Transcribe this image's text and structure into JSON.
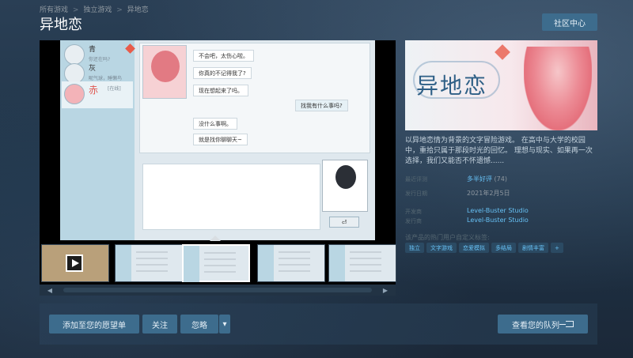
{
  "breadcrumb": [
    "所有游戏",
    "独立游戏",
    "异地恋"
  ],
  "breadcrumb_sep": ">",
  "title": "异地恋",
  "community_button": "社区中心",
  "screenshot": {
    "contacts": [
      {
        "name": "青",
        "sub": "你还在吗?"
      },
      {
        "name": "灰",
        "sub": "昵气球，睡懒鸟"
      },
      {
        "name": "赤",
        "sub": "[在线]"
      }
    ],
    "messages": [
      {
        "text": "不会吧，太伤心啦。",
        "me": false
      },
      {
        "text": "你真的不记得我了?",
        "me": false
      },
      {
        "text": "现在想起来了吗。",
        "me": false
      },
      {
        "text": "找我有什么事吗?",
        "me": true
      },
      {
        "text": "没什么事啊。",
        "me": false
      },
      {
        "text": "就是找你聊聊天~",
        "me": false
      }
    ]
  },
  "capsule_logo": "异地恋",
  "description": "以异地恋情为背景的文字冒险游戏。 在高中与大学的校园中，重拾只属于那段时光的回忆。 理想与现实、如果再一次选择，我们又能否不怀遗憾......",
  "meta": {
    "recent_reviews_label": "最近评测",
    "review_value": "多半好评",
    "review_count": "(74)",
    "release_label": "发行日期",
    "release_date": "2021年2月5日",
    "developer_label": "开发商",
    "developer": "Level-Buster Studio",
    "publisher_label": "发行商",
    "publisher": "Level-Buster Studio",
    "tags_label": "该产品的热门用户自定义标签:",
    "tags": [
      "独立",
      "文字游戏",
      "恋爱模拟",
      "多结局",
      "剧情丰富",
      "+"
    ]
  },
  "actions": {
    "wishlist": "添加至您的愿望单",
    "follow": "关注",
    "ignore": "忽略",
    "queue": "查看您的队列"
  },
  "icons": {
    "scroll_left": "◀",
    "scroll_right": "▶",
    "dropdown": "▾"
  }
}
